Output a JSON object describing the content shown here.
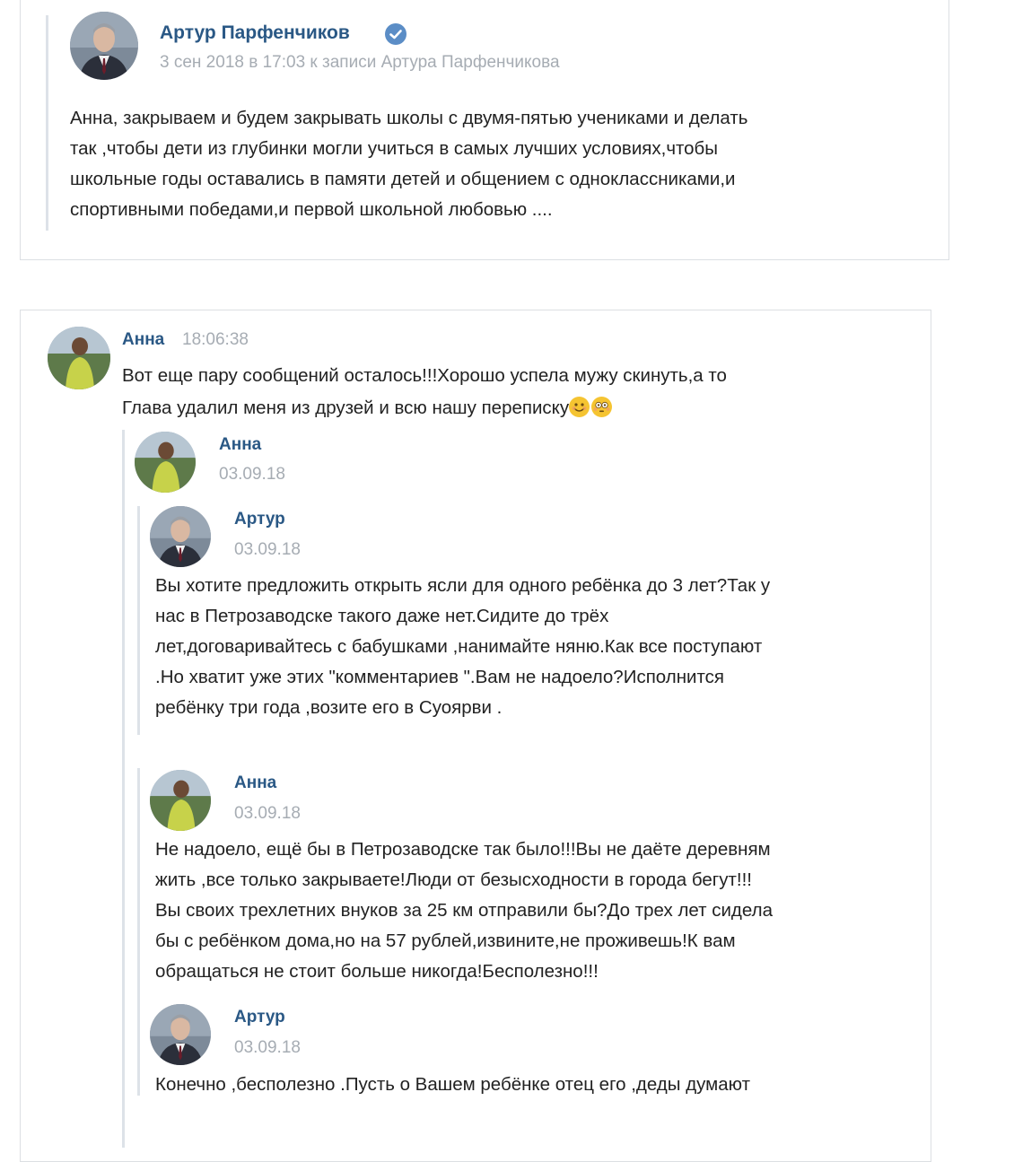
{
  "post_reply": {
    "author": "Артур Парфенчиков",
    "verified_icon": "verified-check-icon",
    "meta": "3 сен 2018 в 17:03 к записи Артура Парфенчикова",
    "lines": [
      "Анна, закрываем и будем закрывать школы с двумя-пятью учениками и делать",
      "так ,чтобы дети из глубинки могли учиться в самых лучших условиях,чтобы",
      "школьные годы оставались в памяти детей и общением с одноклассниками,и",
      "спортивными победами,и первой школьной любовью ...."
    ]
  },
  "chat": {
    "message": {
      "author": "Анна",
      "time": "18:06:38",
      "lines": [
        "Вот еще пару сообщений осталось!!!Хорошо успела мужу скинуть,а то",
        "Глава удалил меня из друзей и всю нашу переписку"
      ],
      "emojis": [
        "smiling-face-emoji",
        "flushed-face-emoji"
      ]
    },
    "forwarded": [
      {
        "author": "Анна",
        "date": "03.09.18",
        "lines": []
      },
      {
        "author": "Артур",
        "date": "03.09.18",
        "lines": [
          "Вы хотите предложить открыть ясли для одного ребёнка до 3 лет?Так у",
          "нас в Петрозаводске такого даже нет.Сидите до трёх",
          "лет,договаривайтесь с бабушками ,нанимайте няню.Как все поступают",
          ".Но хватит уже этих \"комментариев \".Вам не надоело?Исполнится",
          "ребёнку три года ,возите его в Суоярви ."
        ]
      },
      {
        "author": "Анна",
        "date": "03.09.18",
        "lines": [
          "Не надоело, ещё бы в Петрозаводске так было!!!Вы не даёте деревням",
          "жить ,все только закрываете!Люди от безысходности в города бегут!!!",
          "Вы своих трехлетних внуков за 25 км отправили бы?До трех лет сидела",
          "бы с ребёнком дома,но на 57 рублей,извините,не проживешь!К вам",
          "обращаться не стоит больше никогда!Бесполезно!!!"
        ]
      },
      {
        "author": "Артур",
        "date": "03.09.18",
        "lines": [
          "Конечно ,бесполезно .Пусть о Вашем ребёнке отец его ,деды думают"
        ]
      }
    ]
  }
}
